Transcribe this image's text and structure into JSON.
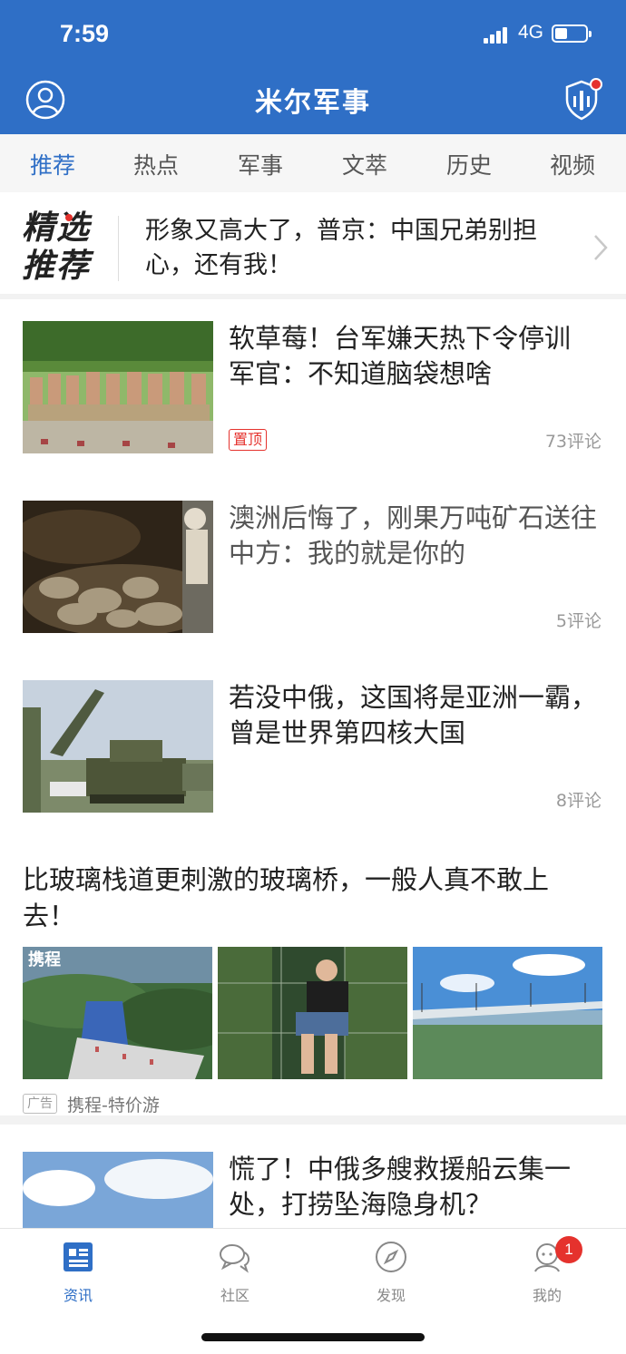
{
  "status_bar": {
    "time": "7:59",
    "network": "4G"
  },
  "header": {
    "title": "米尔军事"
  },
  "tabs": [
    {
      "label": "推荐",
      "active": true
    },
    {
      "label": "热点"
    },
    {
      "label": "军事"
    },
    {
      "label": "文萃"
    },
    {
      "label": "历史"
    },
    {
      "label": "视频"
    }
  ],
  "featured": {
    "logo_line1": "精选",
    "logo_line2": "推荐",
    "text": "形象又高大了，普京：中国兄弟别担心，还有我！"
  },
  "news": [
    {
      "title": "软草莓！台军嫌天热下令停训 军官：不知道脑袋想啥",
      "badge": "置顶",
      "comments": "73评论"
    },
    {
      "title": "澳洲后悔了，刚果万吨矿石送往中方：我的就是你的",
      "comments": "5评论"
    },
    {
      "title": "若没中俄，这国将是亚洲一霸，曾是世界第四核大国",
      "comments": "8评论"
    },
    {
      "title": "慌了！中俄多艘救援船云集一处，打捞坠海隐身机？"
    }
  ],
  "ad": {
    "title": "比玻璃栈道更刺激的玻璃桥，一般人真不敢上去！",
    "image_watermark": "携程",
    "label": "广告",
    "source": "携程-特价游"
  },
  "bottom_nav": [
    {
      "label": "资讯",
      "icon": "news-icon",
      "active": true
    },
    {
      "label": "社区",
      "icon": "chat-icon"
    },
    {
      "label": "发现",
      "icon": "compass-icon"
    },
    {
      "label": "我的",
      "icon": "profile-icon",
      "badge": "1"
    }
  ],
  "colors": {
    "brand_blue": "#2f6fc6",
    "alert_red": "#e5322d"
  }
}
